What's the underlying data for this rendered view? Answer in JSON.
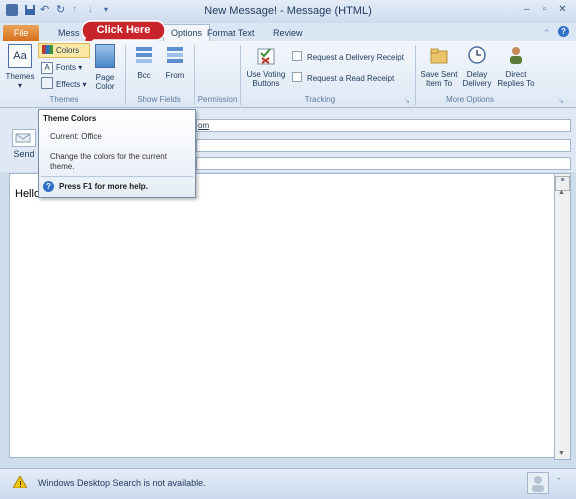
{
  "window": {
    "title": "New Message! - Message (HTML)"
  },
  "tabs": [
    "File",
    "Mess",
    "Options",
    "Format Text",
    "Review"
  ],
  "callout": {
    "label": "Click Here"
  },
  "ribbon": {
    "themes": {
      "label": "Themes",
      "colors": "Colors",
      "fonts": "Fonts",
      "effects": "Effects",
      "page_color": "Page Color",
      "group": "Themes"
    },
    "show_fields": {
      "bcc": "Bcc",
      "from": "From",
      "group": "Show Fields"
    },
    "permission": {
      "group": "Permission"
    },
    "tracking": {
      "voting": "Use Voting Buttons",
      "delivery": "Request a Delivery Receipt",
      "read": "Request a Read Receipt",
      "group": "Tracking"
    },
    "more_options": {
      "save_sent": "Save Sent Item To",
      "delay": "Delay Delivery",
      "direct": "Direct Replies To",
      "group": "More Options"
    }
  },
  "compose": {
    "send": "Send",
    "to_suffix": "om",
    "body_text": "Hello!"
  },
  "tooltip": {
    "title": "Theme Colors",
    "current": "Current: Office",
    "description": "Change the colors for the current theme.",
    "help": "Press F1 for more help."
  },
  "status": {
    "message": "Windows Desktop Search is not available."
  },
  "colors": {
    "accent": "#d6711d",
    "callout": "#c8242b"
  }
}
